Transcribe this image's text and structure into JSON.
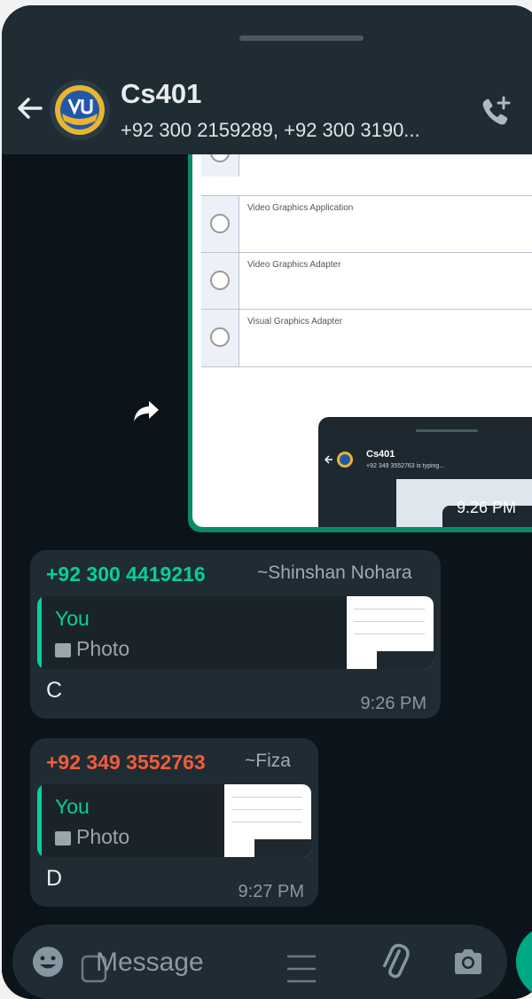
{
  "header": {
    "title": "Cs401",
    "subtitle": "+92 300 2159289, +92 300 3190..."
  },
  "shared_image": {
    "options": [
      "",
      "Video Graphics Application",
      "Video Graphics Adapter",
      "Visual Graphics Adapter"
    ],
    "mini_title": "Cs401",
    "mini_subtitle": "+92 349 3552763 is typing...",
    "time": "9:26 PM"
  },
  "messages": [
    {
      "sender": "+92 300 4419216",
      "sender_color": "#06cf9c",
      "pushname": "~Shinshan Nohara",
      "quote_author": "You",
      "quote_type": "Photo",
      "text": "C",
      "time": "9:26 PM"
    },
    {
      "sender": "+92 349 3552763",
      "sender_color": "#f15c3b",
      "pushname": "~Fiza",
      "quote_author": "You",
      "quote_type": "Photo",
      "text": "D",
      "time": "9:27 PM"
    }
  ],
  "composer": {
    "placeholder": "Message"
  },
  "icons": {
    "back": "back-arrow-icon",
    "call": "add-call-icon",
    "forward": "forward-icon",
    "emoji": "emoji-icon",
    "attach": "paperclip-icon",
    "camera": "camera-icon"
  }
}
